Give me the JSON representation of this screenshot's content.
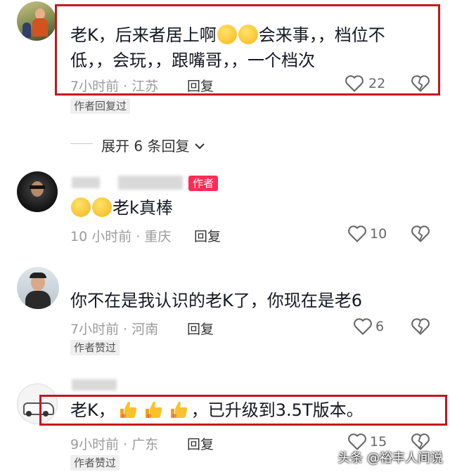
{
  "comments": [
    {
      "text_a": "老K，后来者居上啊",
      "text_b": "会来事，，档位不",
      "text_c": "低，，会玩，，跟嘴哥，，一个档次",
      "time_location": "7小时前 · 江苏",
      "reply": "回复",
      "likes": "22",
      "tag": "作者回复过"
    },
    {
      "text": "老k真棒",
      "time_location": "10 小时前 · 重庆",
      "reply": "回复",
      "likes": "10",
      "author_badge": "作者"
    },
    {
      "text": "你不在是我认识的老K了，你现在是老6",
      "time_location": "7小时前 · 河南",
      "reply": "回复",
      "likes": "6",
      "tag": "作者赞过"
    },
    {
      "text_a": "老K，",
      "text_b": "，已升级到3.5T版本。",
      "time_location": "9小时前 · 广东",
      "reply": "回复",
      "likes": "15",
      "tag": "作者赞过"
    }
  ],
  "expand": {
    "label": "展开 6 条回复"
  },
  "watermark": {
    "text": "头条 @裕丰人间说"
  },
  "colors": {
    "highlight_box": "#c8141e",
    "author_badge": "#fe2c55"
  }
}
